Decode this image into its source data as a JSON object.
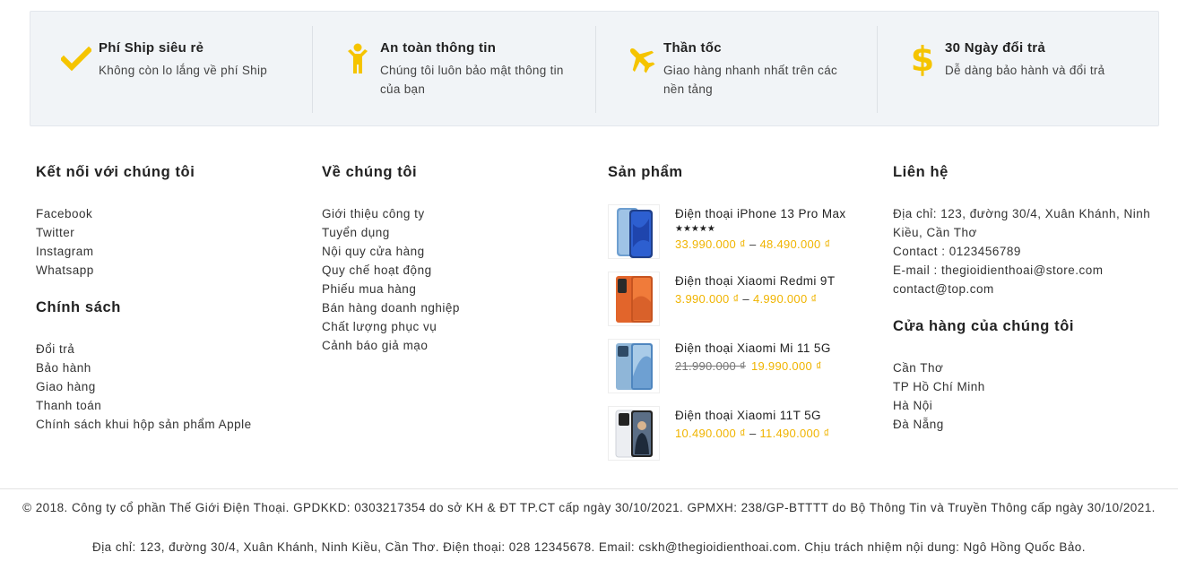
{
  "colors": {
    "accent": "#f5c400",
    "price": "#f0b400",
    "background": "#f1f4f7"
  },
  "features": [
    {
      "icon": "check-icon",
      "title": "Phí Ship siêu rẻ",
      "desc": "Không còn lo lắng về phí Ship"
    },
    {
      "icon": "child-icon",
      "title": "An toàn thông tin",
      "desc": "Chúng tôi luôn bảo mật thông tin của bạn"
    },
    {
      "icon": "plane-icon",
      "title": "Thần tốc",
      "desc": "Giao hàng nhanh nhất trên các nền tảng"
    },
    {
      "icon": "dollar-icon",
      "title": "30 Ngày đổi trả",
      "desc": "Dễ dàng bảo hành và đổi trả"
    }
  ],
  "connect": {
    "title": "Kết nối với chúng tôi",
    "items": [
      "Facebook",
      "Twitter",
      "Instagram",
      "Whatsapp"
    ]
  },
  "policy": {
    "title": "Chính sách",
    "items": [
      "Đổi trả",
      "Bảo hành",
      "Giao hàng",
      "Thanh toán",
      "Chính sách khui hộp sản phẩm Apple"
    ]
  },
  "about": {
    "title": "Về chúng tôi",
    "items": [
      "Giới thiệu công ty",
      "Tuyển dụng",
      "Nội quy cửa hàng",
      "Quy chế hoạt động",
      "Phiếu mua hàng",
      "Bán hàng doanh nghiệp",
      "Chất lượng phục vụ",
      "Cảnh báo giả mạo"
    ]
  },
  "products": {
    "title": "Sản phẩm",
    "items": [
      {
        "name": "Điện thoại iPhone 13 Pro Max",
        "stars": "★★★★★",
        "price_low": "33.990.000 ₫",
        "price_high": "48.490.000 ₫"
      },
      {
        "name": "Điện thoại Xiaomi Redmi 9T",
        "price_low": "3.990.000 ₫",
        "price_high": "4.990.000 ₫"
      },
      {
        "name": "Điện thoại Xiaomi Mi 11 5G",
        "price_old": "21.990.000 ₫",
        "price_new": "19.990.000 ₫"
      },
      {
        "name": "Điện thoại Xiaomi 11T 5G",
        "price_low": "10.490.000 ₫",
        "price_high": "11.490.000 ₫"
      }
    ]
  },
  "contact": {
    "title": "Liên hệ",
    "address": "Địa chỉ: 123, đường 30/4, Xuân Khánh, Ninh Kiều, Cần Thơ",
    "phone": "Contact : 0123456789",
    "email": "E-mail : thegioidienthoai@store.com",
    "email2": "contact@top.com"
  },
  "stores": {
    "title": "Cửa hàng của chúng tôi",
    "items": [
      "Cần Thơ",
      "TP Hồ Chí Minh",
      "Hà Nội",
      "Đà Nẵng"
    ]
  },
  "footer": {
    "copyright": "© 2018. Công ty cổ phần Thế Giới Điện Thoại. GPDKKD: 0303217354 do sở KH & ĐT TP.CT cấp ngày 30/10/2021. GPMXH: 238/GP-BTTTT do Bộ Thông Tin và Truyền Thông cấp ngày 30/10/2021.",
    "address": "Địa chỉ: 123, đường 30/4, Xuân Khánh, Ninh Kiều, Cần Thơ. Điện thoại: 028 12345678. Email: cskh@thegioidienthoai.com. Chịu trách nhiệm nội dung: Ngô Hồng Quốc Bảo."
  }
}
